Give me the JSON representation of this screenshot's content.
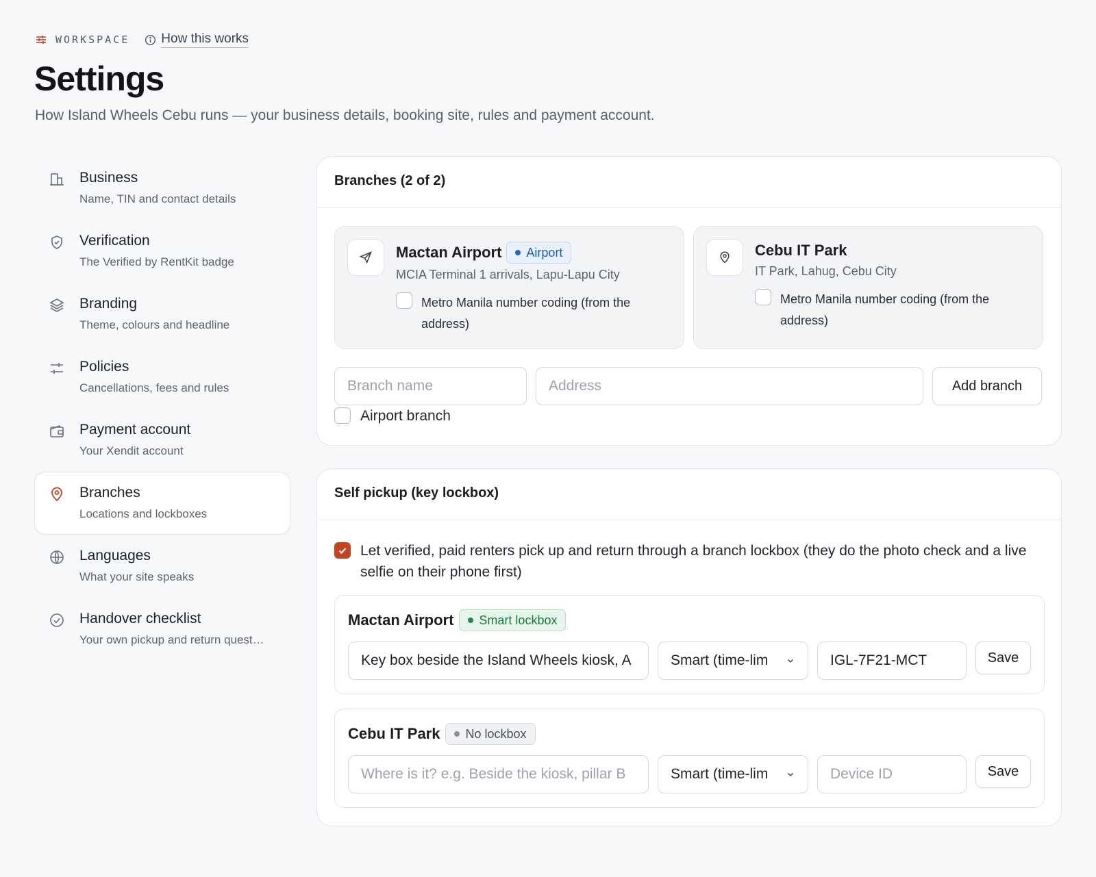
{
  "header": {
    "eyebrow": "WORKSPACE",
    "how_link": "How this works",
    "title": "Settings",
    "subtitle": "How Island Wheels Cebu runs — your business details, booking site, rules and payment account."
  },
  "sidebar": {
    "items": [
      {
        "title": "Business",
        "desc": "Name, TIN and contact details",
        "icon": "building-icon"
      },
      {
        "title": "Verification",
        "desc": "The Verified by RentKit badge",
        "icon": "shield-check-icon"
      },
      {
        "title": "Branding",
        "desc": "Theme, colours and headline",
        "icon": "layers-icon"
      },
      {
        "title": "Policies",
        "desc": "Cancellations, fees and rules",
        "icon": "sliders-icon"
      },
      {
        "title": "Payment account",
        "desc": "Your Xendit account",
        "icon": "wallet-icon"
      },
      {
        "title": "Branches",
        "desc": "Locations and lockboxes",
        "icon": "map-pin-icon",
        "active": true
      },
      {
        "title": "Languages",
        "desc": "What your site speaks",
        "icon": "globe-icon"
      },
      {
        "title": "Handover checklist",
        "desc": "Your own pickup and return quest…",
        "icon": "check-circle-icon"
      }
    ]
  },
  "branches": {
    "heading": "Branches (2 of 2)",
    "list": [
      {
        "name": "Mactan Airport",
        "badge": "Airport",
        "address": "MCIA Terminal 1 arrivals, Lapu-Lapu City",
        "coding_label": "Metro Manila number coding (from the address)",
        "coding_checked": false,
        "icon": "send-icon"
      },
      {
        "name": "Cebu IT Park",
        "address": "IT Park, Lahug, Cebu City",
        "coding_label": "Metro Manila number coding (from the address)",
        "coding_checked": false,
        "icon": "map-pin-icon"
      }
    ],
    "form": {
      "name_placeholder": "Branch name",
      "address_placeholder": "Address",
      "add_button": "Add branch",
      "airport_label": "Airport branch",
      "airport_checked": false
    }
  },
  "self_pickup": {
    "heading": "Self pickup (key lockbox)",
    "enable_label": "Let verified, paid renters pick up and return through a branch lockbox (they do the photo check and a live selfie on their phone first)",
    "enabled": true,
    "lockboxes": [
      {
        "branch": "Mactan Airport",
        "status": "Smart lockbox",
        "location_value": "Key box beside the Island Wheels kiosk, A",
        "location_placeholder": "",
        "type": "Smart (time-lim",
        "device_value": "IGL-7F21-MCT",
        "device_placeholder": "",
        "save": "Save"
      },
      {
        "branch": "Cebu IT Park",
        "status": "No lockbox",
        "location_value": "",
        "location_placeholder": "Where is it? e.g. Beside the kiosk, pillar B",
        "type": "Smart (time-lim",
        "device_value": "",
        "device_placeholder": "Device ID",
        "save": "Save"
      }
    ]
  },
  "colors": {
    "accent": "#c4441f",
    "airport_badge": "#2466c2",
    "smart_badge": "#1e8a43"
  }
}
